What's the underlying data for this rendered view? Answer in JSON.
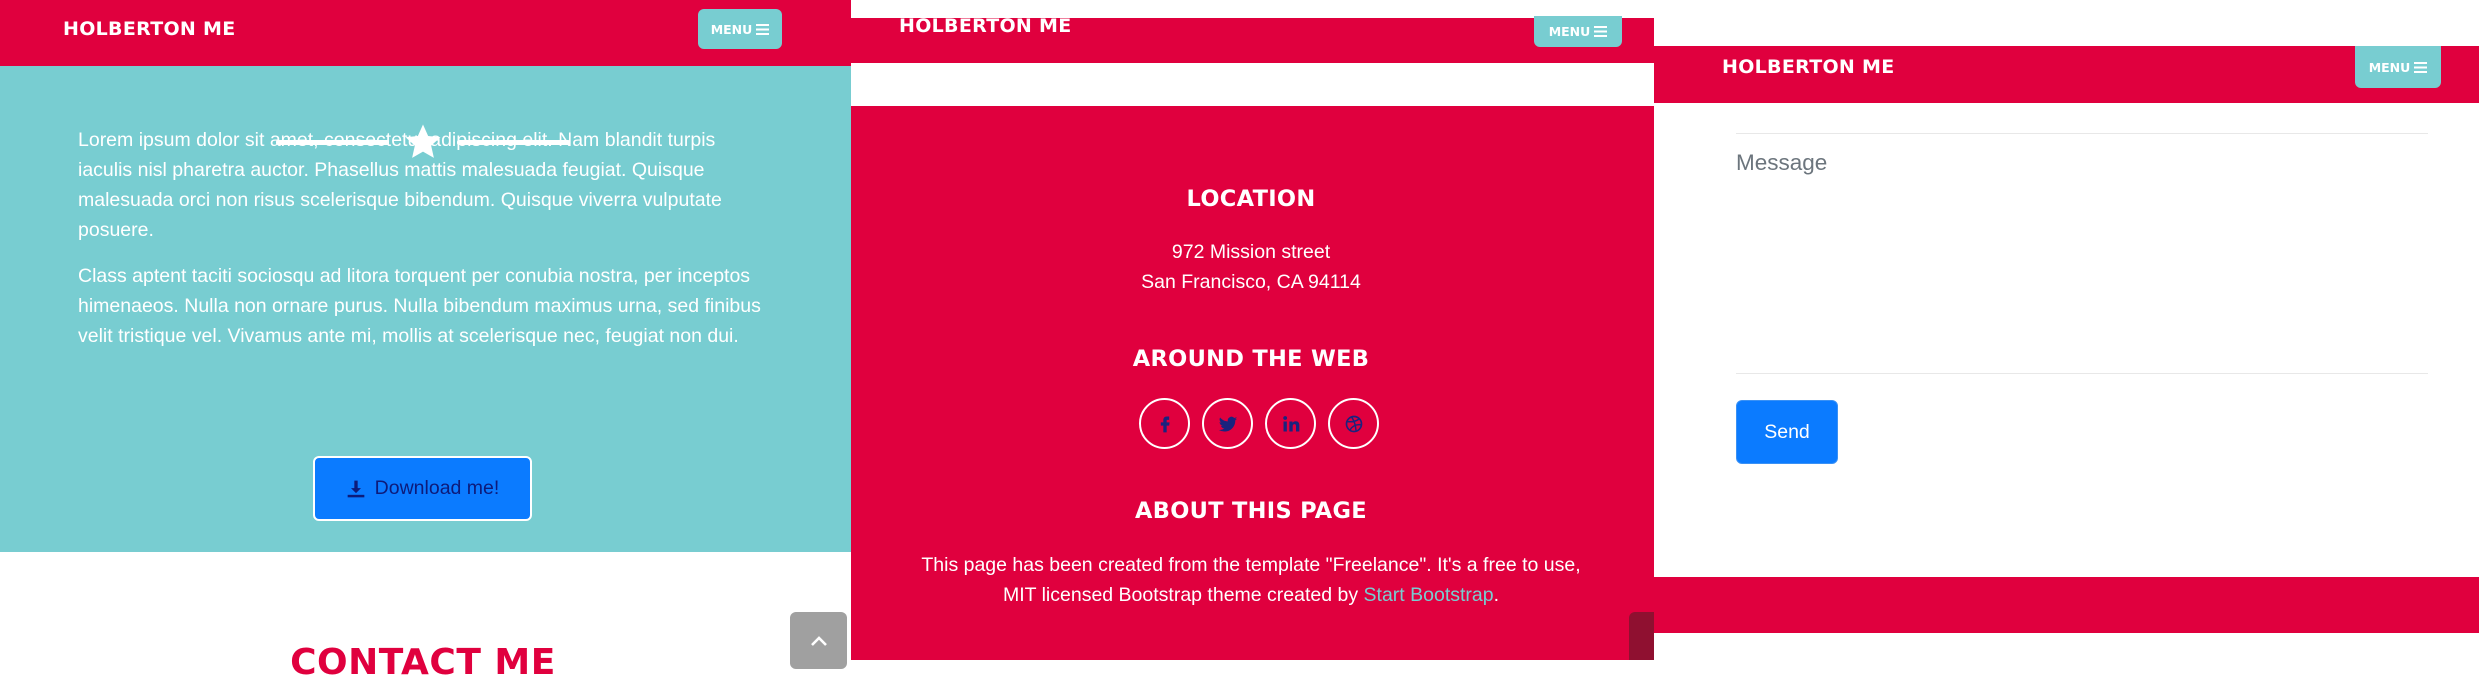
{
  "colors": {
    "primary_red": "#e0003e",
    "teal": "#78cdd1",
    "button_blue": "#0b7bff",
    "link_teal": "#78cdd1"
  },
  "panel1": {
    "navbar": {
      "brand": "HOLBERTON ME",
      "menu_label": "MENU"
    },
    "paragraphs": [
      "Lorem ipsum dolor sit amet, consectetur adipiscing elit. Nam blandit turpis iaculis nisl pharetra auctor. Phasellus mattis malesuada feugiat. Quisque malesuada orci non risus scelerisque bibendum. Quisque viverra vulputate posuere.",
      "Class aptent taciti sociosqu ad litora torquent per conubia nostra, per inceptos himenaeos. Nulla non ornare purus. Nulla bibendum maximus urna, sed finibus velit tristique vel. Vivamus ante mi, mollis at scelerisque nec, feugiat non dui."
    ],
    "download_label": "Download me!",
    "contact_title": "CONTACT ME"
  },
  "panel2": {
    "navbar": {
      "brand": "HOLBERTON ME",
      "menu_label": "MENU"
    },
    "location": {
      "heading": "LOCATION",
      "line1": "972 Mission street",
      "line2": "San Francisco, CA 94114"
    },
    "web": {
      "heading": "AROUND THE WEB",
      "icons": [
        "facebook-icon",
        "twitter-icon",
        "linkedin-icon",
        "dribbble-icon"
      ]
    },
    "about": {
      "heading": "ABOUT THIS PAGE",
      "text": "This page has been created from the template \"Freelance\". It's a free to use, MIT licensed Bootstrap theme created by ",
      "link_text": "Start Bootstrap",
      "suffix": "."
    }
  },
  "panel3": {
    "navbar": {
      "brand": "HOLBERTON ME",
      "menu_label": "MENU"
    },
    "message_placeholder": "Message",
    "send_label": "Send"
  }
}
